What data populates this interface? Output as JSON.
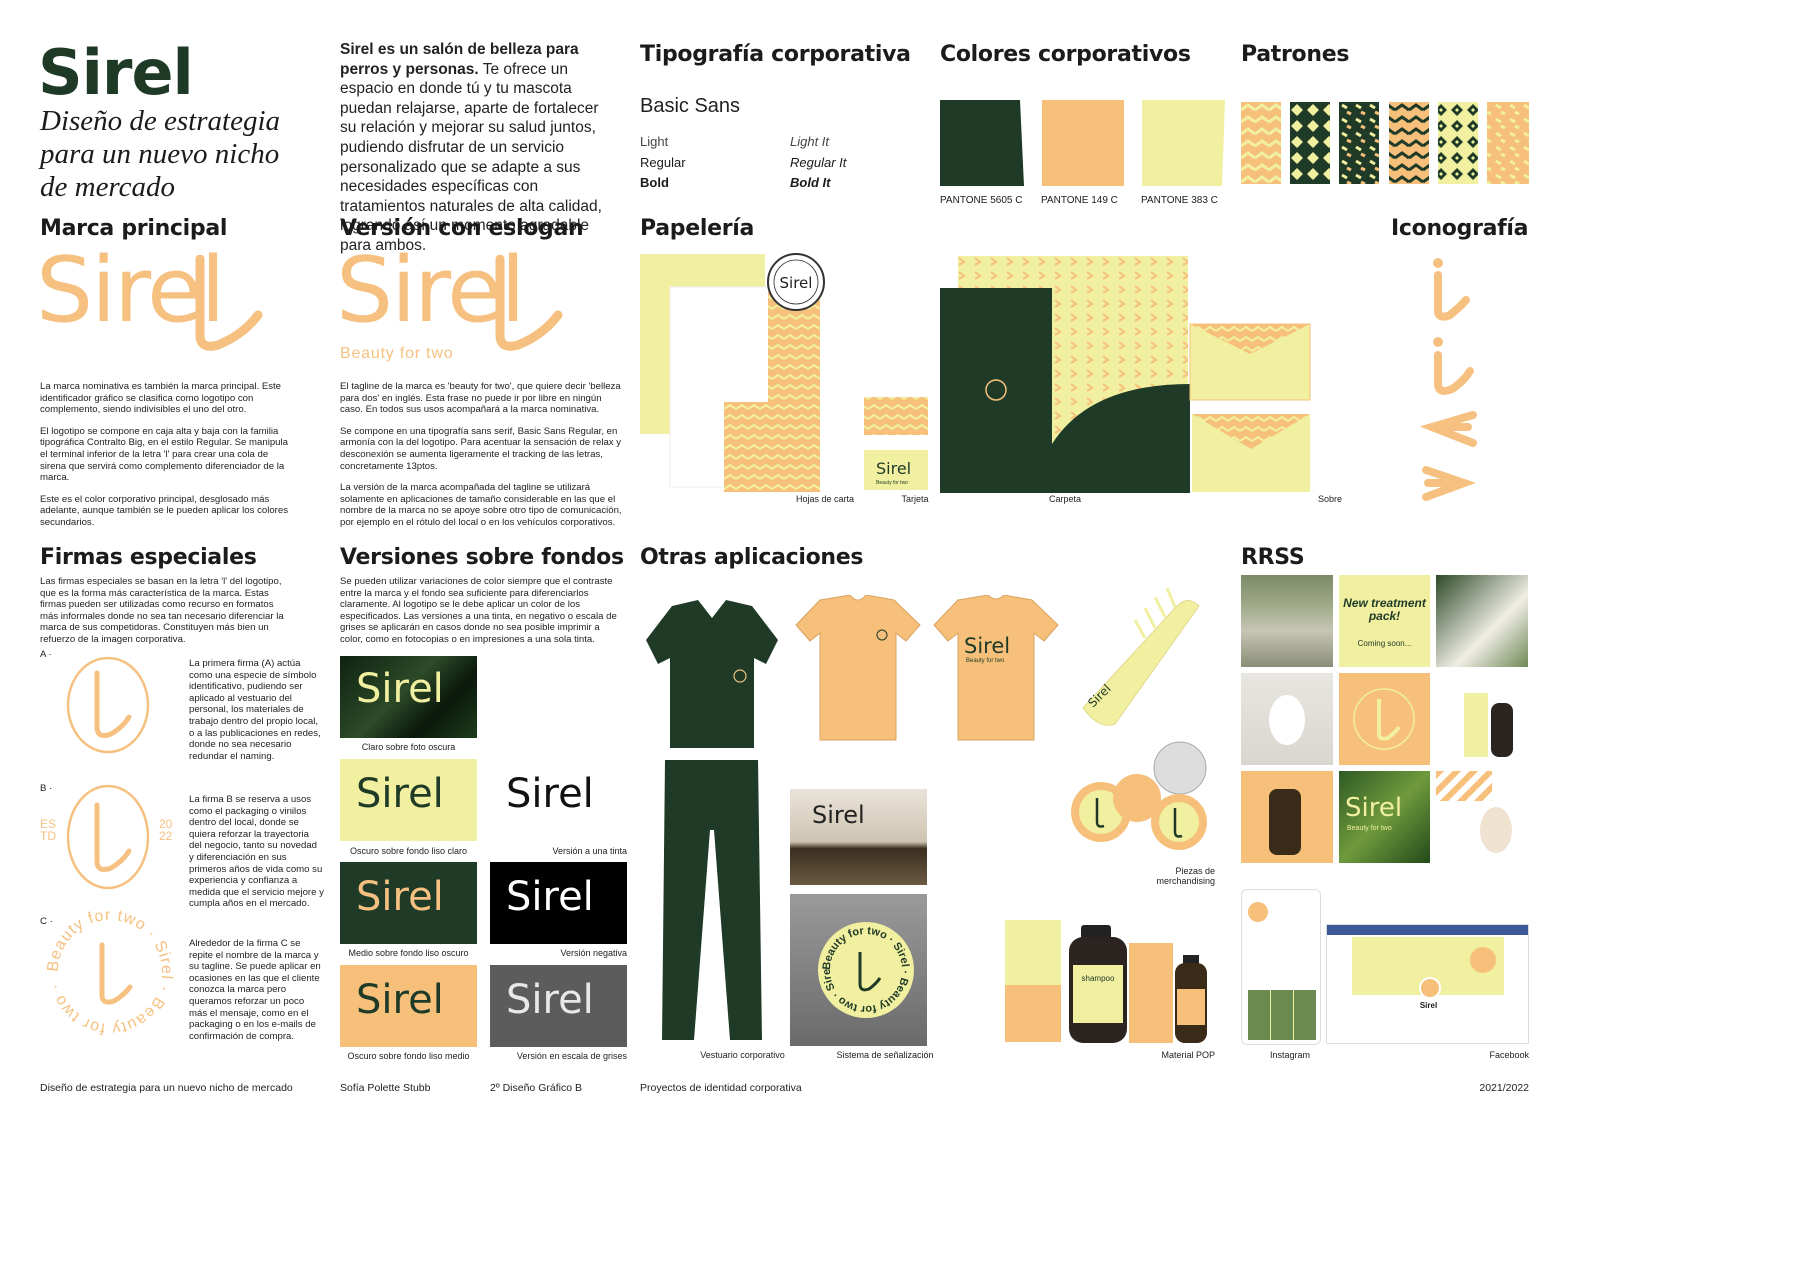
{
  "header": {
    "brand": "Sirel",
    "subtitle_lines": [
      "Diseño de estrategia",
      "para un nuevo nicho",
      "de mercado"
    ],
    "intro_bold": "Sirel es un salón de belleza para perros y personas.",
    "intro_rest": " Te ofrece un espacio en donde tú y tu mascota puedan relajarse, aparte de fortalecer su relación y mejorar su salud juntos, pudiendo disfrutar de un servicio personalizado que se adapte a sus necesidades específicas con tratamientos naturales de alta calidad, logrando así un momento agradable para ambos."
  },
  "typography": {
    "title": "Tipografía corporativa",
    "font_name": "Basic Sans",
    "weights": [
      "Light",
      "Regular",
      "Bold"
    ],
    "italics": [
      "Light It",
      "Regular It",
      "Bold It"
    ]
  },
  "colors": {
    "title": "Colores corporativos",
    "items": [
      {
        "label": "PANTONE 5605 C",
        "hex": "#1f3a27"
      },
      {
        "label": "PANTONE 149 C",
        "hex": "#f6c07b"
      },
      {
        "label": "PANTONE 383 C",
        "hex": "#f1efa0"
      }
    ]
  },
  "patterns": {
    "title": "Patrones"
  },
  "marca": {
    "title": "Marca principal",
    "logo": "Sirel",
    "paragraphs": [
      "La marca nominativa es también la marca principal. Este identificador gráfico se clasifica como logotipo con complemento, siendo indivisibles el uno del otro.",
      "El logotipo se compone en caja alta y baja con la familia tipográfica Contralto Big, en el estilo Regular. Se manipula el terminal inferior de la letra 'l' para crear una cola de sirena que servirá como complemento diferenciador de la marca.",
      "Este es el color corporativo principal, desglosado más adelante, aunque también se le pueden aplicar los colores secundarios."
    ]
  },
  "eslogan": {
    "title": "Versión con eslogan",
    "logo": "Sirel",
    "tagline": "Beauty for two",
    "paragraphs": [
      "El tagline de la marca es 'beauty for two', que quiere decir 'belleza para dos' en inglés. Esta frase no puede ir por libre en ningún caso. En todos sus usos acompañará a la marca nominativa.",
      "Se compone en una tipografía sans serif, Basic Sans Regular, en armonía con la del logotipo. Para acentuar la sensación de relax y desconexión se aumenta ligeramente el tracking de las letras, concretamente 13ptos.",
      "La versión de la marca acompañada del tagline se utilizará solamente en aplicaciones de tamaño considerable en las que el nombre de la marca no se apoye sobre otro tipo de comunicación, por ejemplo en el rótulo del local o en los vehículos corporativos."
    ]
  },
  "papeleria": {
    "title": "Papelería",
    "captions": [
      "Hojas de carta",
      "Tarjeta",
      "Carpeta",
      "Sobre"
    ],
    "card_logo": "Sirel",
    "card_tagline": "Beauty for two",
    "stamp_text": "Sirel"
  },
  "iconografia": {
    "title": "Iconografía"
  },
  "firmas": {
    "title": "Firmas especiales",
    "intro": "Las firmas especiales se basan en la letra 'l' del logotipo, que es la forma más característica de la marca. Estas firmas pueden ser utilizadas como recurso en formatos más informales donde no sea tan necesario diferenciar la marca de sus competidoras. Constituyen más bien un refuerzo de la imagen corporativa.",
    "items": [
      {
        "label": "A ·",
        "text": "La primera firma (A) actúa como una especie de símbolo identificativo, pudiendo ser aplicado al vestuario del personal, los materiales de trabajo dentro del propio local, o a las publicaciones en redes, donde no sea necesario redundar el naming."
      },
      {
        "label": "B ·",
        "text": "La firma B se reserva a usos como el packaging o vinilos dentro del local, donde se quiera reforzar la trayectoria del negocio, tanto su novedad y diferenciación en sus primeros años de vida como su experiencia y confianza a medida que el servicio mejore y cumpla años en el mercado."
      },
      {
        "label": "C ·",
        "text": "Alrededor de la firma C se repite el nombre de la marca y su tagline. Se puede aplicar en ocasiones en las que el cliente conozca la marca pero queramos reforzar un poco más el mensaje, como en el packaging o en los e-mails de confirmación de compra."
      }
    ],
    "estd_left": [
      "ES",
      "TD"
    ],
    "estd_right": [
      "20",
      "22"
    ],
    "ring_text": "Beauty for two · Sirel · Beauty for two · Sirel ·"
  },
  "fondos": {
    "title": "Versiones sobre fondos",
    "intro": "Se pueden utilizar variaciones de color siempre que el contraste entre la marca y el fondo sea suficiente para diferenciarlos claramente. Al logotipo se le debe aplicar un color de los especificados. Las versiones a una tinta, en negativo o escala de grises se aplicarán en casos donde no sea posible imprimir a color, como en fotocopias o en impresiones a una sola tinta.",
    "logo": "Sirel",
    "captions": [
      "Claro sobre foto oscura",
      "Oscuro sobre fondo liso claro",
      "Versión a una tinta",
      "Medio sobre fondo liso oscuro",
      "Versión negativa",
      "Oscuro sobre fondo liso medio",
      "Versión en escala de grises"
    ]
  },
  "otras": {
    "title": "Otras aplicaciones",
    "captions": [
      "Vestuario corporativo",
      "Sistema de señalización",
      "Piezas de merchandising",
      "Material POP"
    ],
    "shirt_logo": "Sirel",
    "shirt_tagline": "Beauty for two",
    "store_logo": "Sirel",
    "sign_ring": "Beauty for two · Sirel · Beauty for two · Sirel ·",
    "comb_logo": "Sirel",
    "bottle_label": "shampoo"
  },
  "rrss": {
    "title": "RRSS",
    "post_title": "New treatment pack!",
    "post_sub": "Coming soon...",
    "post_logo": "Sirel",
    "post_tagline": "Beauty for two",
    "fb_name": "Sirel",
    "captions": [
      "Instagram",
      "Facebook"
    ]
  },
  "footer": {
    "left": "Diseño de estrategia para un nuevo nicho de mercado",
    "author": "Sofía Polette Stubb",
    "course": "2º Diseño Gráfico B",
    "project": "Proyectos de identidad corporativa",
    "year": "2021/2022"
  }
}
